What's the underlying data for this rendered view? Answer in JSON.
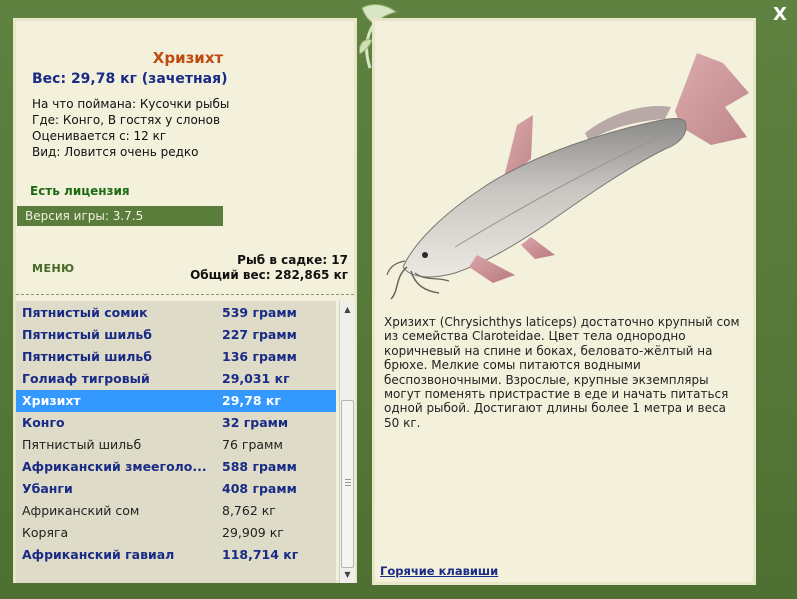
{
  "window": {
    "close_glyph": "X"
  },
  "fish": {
    "title": "Хризихт",
    "weight": "Вес: 29,78 кг (зачетная)",
    "info": [
      "На что поймана: Кусочки рыбы",
      "Где: Конго, В гостях у слонов",
      "Оценивается с: 12 кг",
      "Вид: Ловится очень редко"
    ],
    "license": "Есть лицензия",
    "description": "Хризихт (Chrysichthys laticeps) достаточно крупный сом из семейства Claroteidae. Цвет тела однородно коричневый на спине и боках, беловато-жёлтый на брюхе. Мелкие сомы питаются водными беспозвоночными. Взрослые, крупные экземпляры могут поменять пристрастие в еде и начать питаться одной рыбой. Достигают длины более 1 метра и веса 50 кг."
  },
  "version": "Версия игры: 3.7.5",
  "menu_label": "МЕНЮ",
  "stats": {
    "fish_in_keepnet": "Рыб в садке: 17",
    "total_weight": "Общий вес: 282,865 кг"
  },
  "catch_list": [
    {
      "name": "Пятнистый сомик",
      "weight": "539 грамм",
      "style": "bold"
    },
    {
      "name": "Пятнистый шильб",
      "weight": "227 грамм",
      "style": "bold"
    },
    {
      "name": "Пятнистый шильб",
      "weight": "136 грамм",
      "style": "bold"
    },
    {
      "name": "Голиаф тигровый",
      "weight": "29,031 кг",
      "style": "bold"
    },
    {
      "name": "Хризихт",
      "weight": "29,78 кг",
      "style": "selected"
    },
    {
      "name": "Конго",
      "weight": "32 грамм",
      "style": "bold"
    },
    {
      "name": "Пятнистый шильб",
      "weight": "76 грамм",
      "style": "plain"
    },
    {
      "name": "Африканский змееголо...",
      "weight": "588 грамм",
      "style": "bold"
    },
    {
      "name": "Убанги",
      "weight": "408 грамм",
      "style": "bold"
    },
    {
      "name": "Африканский сом",
      "weight": "8,762 кг",
      "style": "plain"
    },
    {
      "name": "Коряга",
      "weight": "29,909 кг",
      "style": "plain"
    },
    {
      "name": "Африканский гавиал",
      "weight": "118,714 кг",
      "style": "bold"
    }
  ],
  "hotkeys_label": "Горячие клавиши",
  "colors": {
    "frame": "#55773a",
    "panel": "#f3f1dc",
    "title": "#c04a10",
    "accent_blue": "#1a2b86",
    "selected": "#3399ff",
    "license": "#1e6a12"
  }
}
